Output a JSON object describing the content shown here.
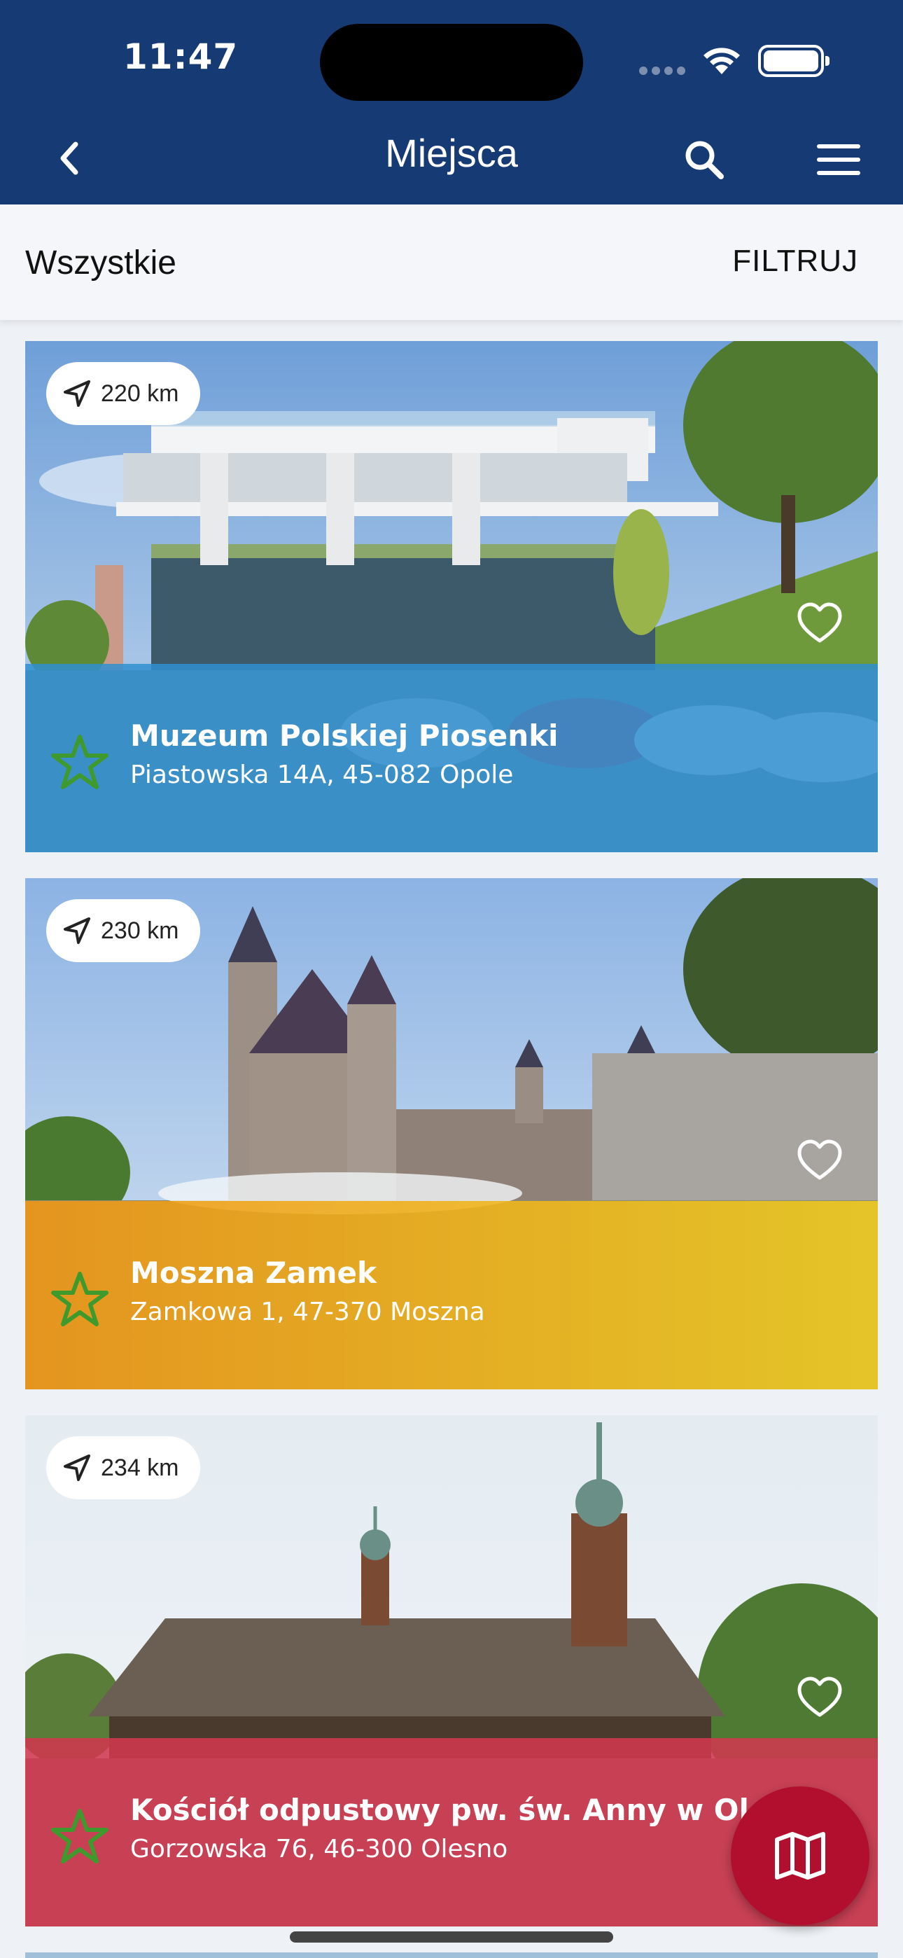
{
  "status_bar": {
    "time": "11:47"
  },
  "header": {
    "title": "Miejsca"
  },
  "filter": {
    "label": "Wszystkie",
    "button": "FILTRUJ"
  },
  "places": [
    {
      "distance": "220 km",
      "name": "Muzeum Polskiej Piosenki",
      "address": "Piastowska 14A, 45-082 Opole",
      "band_color": "#2f8fd0"
    },
    {
      "distance": "230 km",
      "name": "Moszna Zamek",
      "address": "Zamkowa 1, 47-370 Moszna",
      "band_color": "#f0b51a"
    },
    {
      "distance": "234 km",
      "name": "Kościół odpustowy pw. św. Anny w Oleśnie",
      "address": "Gorzowska 76, 46-300 Olesno",
      "band_color": "#d0384f"
    }
  ],
  "colors": {
    "header_bg": "#163a74",
    "star": "#3e9a2c",
    "fab": "#b20f2e"
  },
  "icons": {
    "back": "chevron-left-icon",
    "search": "search-icon",
    "menu": "hamburger-icon",
    "distance": "navigation-arrow-icon",
    "favorite": "heart-icon",
    "rating": "star-icon",
    "map": "map-icon"
  }
}
